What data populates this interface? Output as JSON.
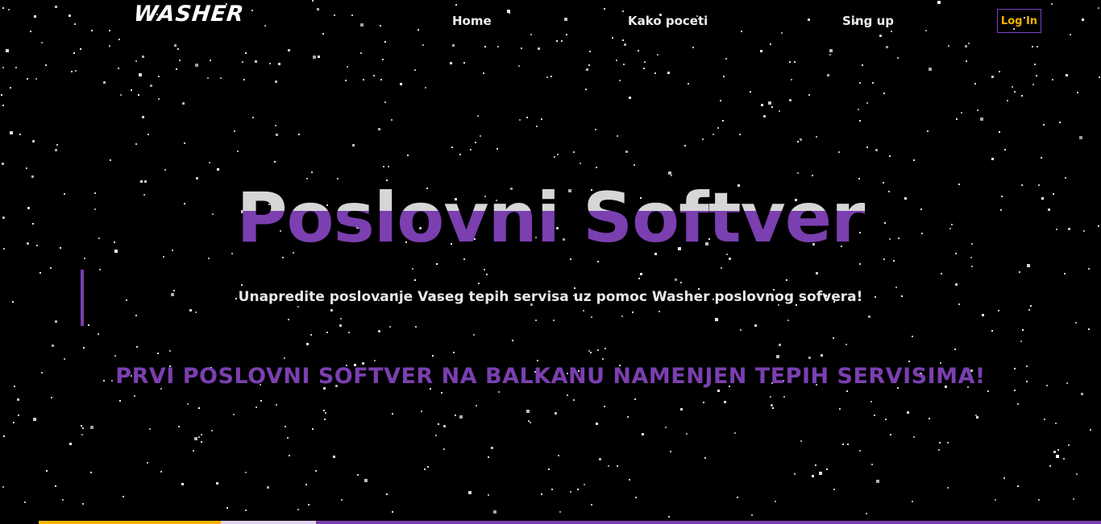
{
  "header": {
    "logo": "WASHER",
    "nav": {
      "home": "Home",
      "how_to_start": "Kako poceti",
      "sign_up": "Sing up"
    },
    "login_label": "Log In"
  },
  "hero": {
    "title": "Poslovni Softver",
    "subtitle": "Unapredite poslovanje Vaseg tepih servisa uz pomoc Washer poslovnog sofvera!",
    "tagline": "PRVI POSLOVNI SOFTVER NA BALKANU NAMENJEN TEPIH SERVISIMA!"
  },
  "colors": {
    "background": "#000000",
    "accent_purple": "#7b3fb0",
    "accent_yellow": "#f5b400",
    "title_light": "#d6d6d6"
  },
  "icons": {
    "background": "starfield"
  }
}
